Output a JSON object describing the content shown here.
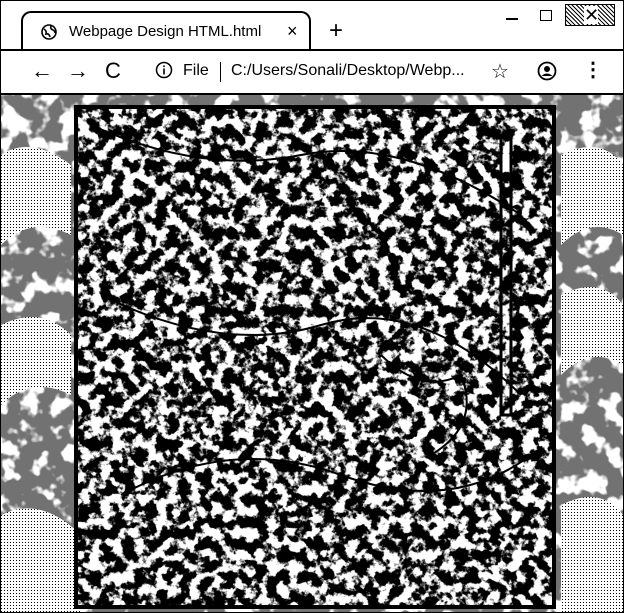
{
  "tab": {
    "title": "Webpage Design HTML.html",
    "favicon": "globe-icon",
    "close_glyph": "×"
  },
  "newtab_glyph": "+",
  "window_controls": {
    "minimize": "minimize-icon",
    "maximize": "maximize-icon",
    "close_glyph": "✕"
  },
  "toolbar": {
    "back_glyph": "←",
    "forward_glyph": "→",
    "reload_glyph": "C",
    "info_icon": "info-icon",
    "scheme_label": "File",
    "url": "C:/Users/Sonali/Desktop/Webp...",
    "bookmark_glyph": "☆",
    "profile_icon": "profile-icon",
    "menu_glyph": "⋮"
  },
  "content": {
    "description_icon": "background-image",
    "colors": {
      "ink": "#000000",
      "paper": "#ffffff"
    }
  }
}
